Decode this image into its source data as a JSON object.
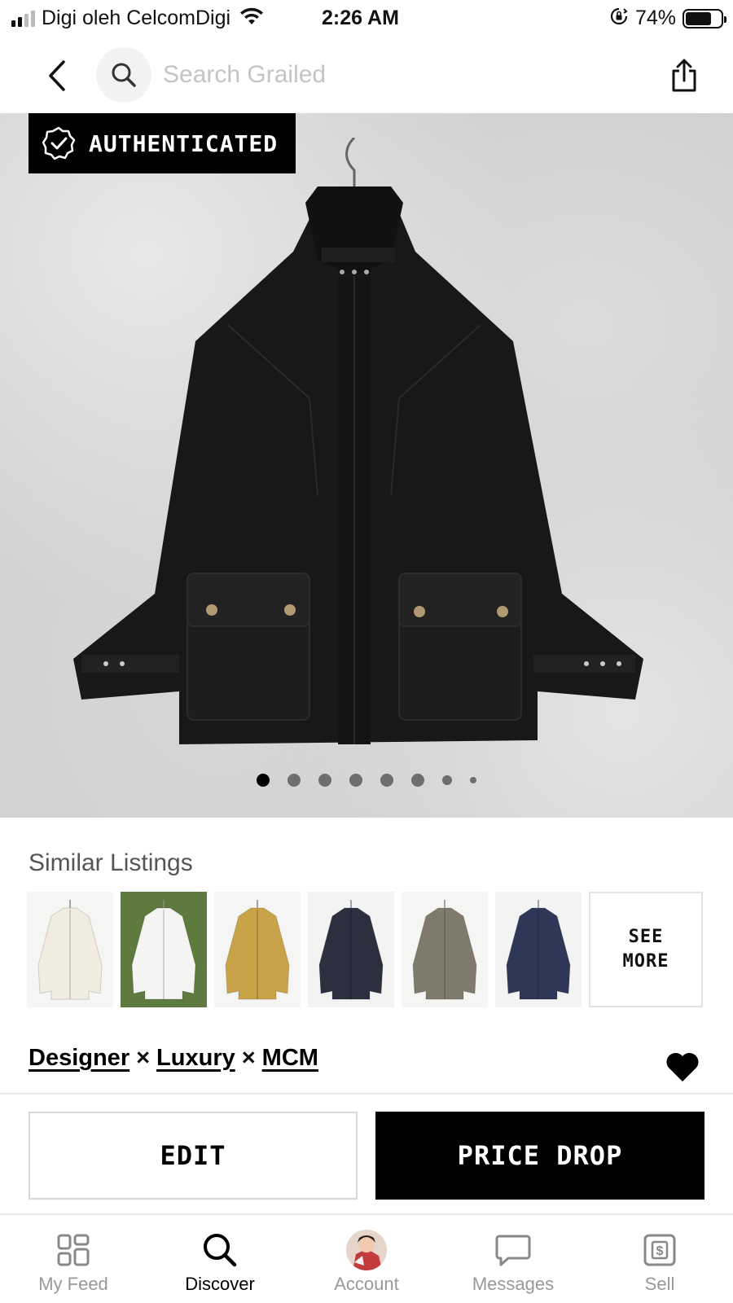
{
  "status_bar": {
    "carrier": "Digi oleh CelcomDigi",
    "time": "2:26 AM",
    "battery_percent": "74%",
    "battery_level": 0.74,
    "signal_bars": 2
  },
  "header": {
    "back_icon": "chevron-left-icon",
    "search_icon": "search-icon",
    "search_placeholder": "Search Grailed",
    "search_value": "",
    "share_icon": "share-icon"
  },
  "hero": {
    "badge_label": "AUTHENTICATED",
    "badge_icon": "verified-badge-icon",
    "image_description_icon": "product-photo-black-jacket",
    "carousel_total": 8,
    "carousel_active": 1
  },
  "similar": {
    "title": "Similar Listings",
    "thumbnails": [
      {
        "name": "cream quilted jacket",
        "color": "#f1ece0"
      },
      {
        "name": "white denim jacket",
        "color": "#f4f4f2"
      },
      {
        "name": "mustard jacket",
        "color": "#c9a34a"
      },
      {
        "name": "navy blazer",
        "color": "#2c2f3e"
      },
      {
        "name": "patchwork blazer",
        "color": "#7f7b6c"
      },
      {
        "name": "navy parka",
        "color": "#2f3758"
      }
    ],
    "see_more_line1": "SEE",
    "see_more_line2": "MORE"
  },
  "listing": {
    "designers": [
      "Designer",
      "Luxury",
      "MCM"
    ],
    "separator": "×",
    "favorited": true
  },
  "actions": {
    "edit_label": "EDIT",
    "price_drop_label": "PRICE DROP"
  },
  "tabs": [
    {
      "label": "My Feed",
      "icon": "grid-icon",
      "active": false
    },
    {
      "label": "Discover",
      "icon": "search-icon",
      "active": true
    },
    {
      "label": "Account",
      "icon": "avatar-icon",
      "active": false
    },
    {
      "label": "Messages",
      "icon": "chat-bubble-icon",
      "active": false
    },
    {
      "label": "Sell",
      "icon": "dollar-tag-icon",
      "active": false
    }
  ],
  "colors": {
    "accent": "#000000",
    "muted_text": "#999999",
    "placeholder": "#c4c4c4"
  }
}
